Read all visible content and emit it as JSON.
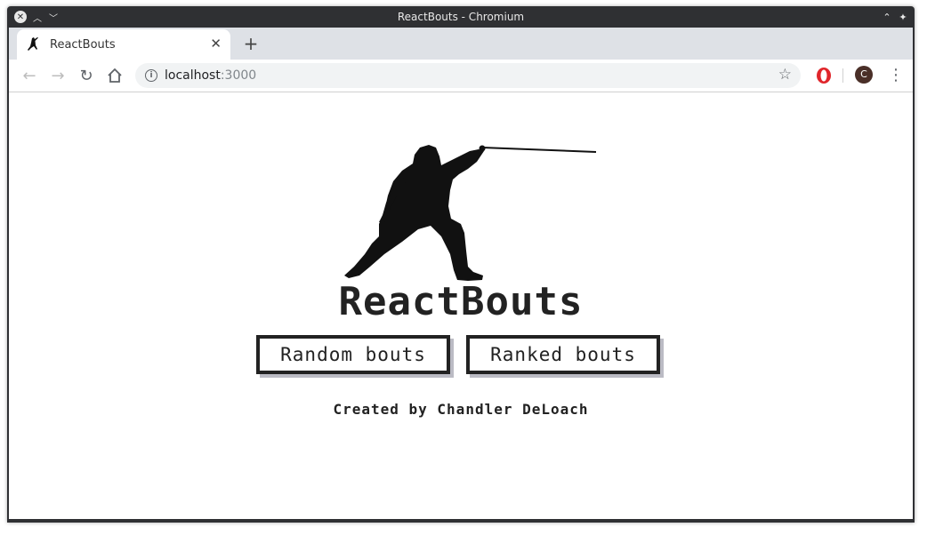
{
  "window": {
    "title": "ReactBouts - Chromium"
  },
  "tab": {
    "label": "ReactBouts",
    "close_glyph": "✕",
    "new_tab_glyph": "+"
  },
  "toolbar": {
    "url_host": "localhost",
    "url_port": ":3000",
    "avatar_letter": "C"
  },
  "page": {
    "brand": "ReactBouts",
    "buttons": {
      "random": "Random bouts",
      "ranked": "Ranked bouts"
    },
    "credit": "Created by Chandler DeLoach"
  },
  "colors": {
    "ink": "#222222",
    "button_shadow": "#bbbbc4",
    "titlebar": "#2f3033",
    "tabstrip": "#dee1e6",
    "omnibox": "#f1f3f4",
    "avatar": "#4a2f28"
  },
  "icons": {
    "close": "close-icon",
    "minimize": "chevron-up-icon",
    "maximize": "chevron-down-icon",
    "back": "back-arrow-icon",
    "forward": "forward-arrow-icon",
    "reload": "reload-icon",
    "home": "home-icon",
    "info": "info-icon",
    "bookmark": "star-icon",
    "extension": "opera-icon",
    "menu": "kebab-menu-icon",
    "favicon": "fencer-icon"
  }
}
